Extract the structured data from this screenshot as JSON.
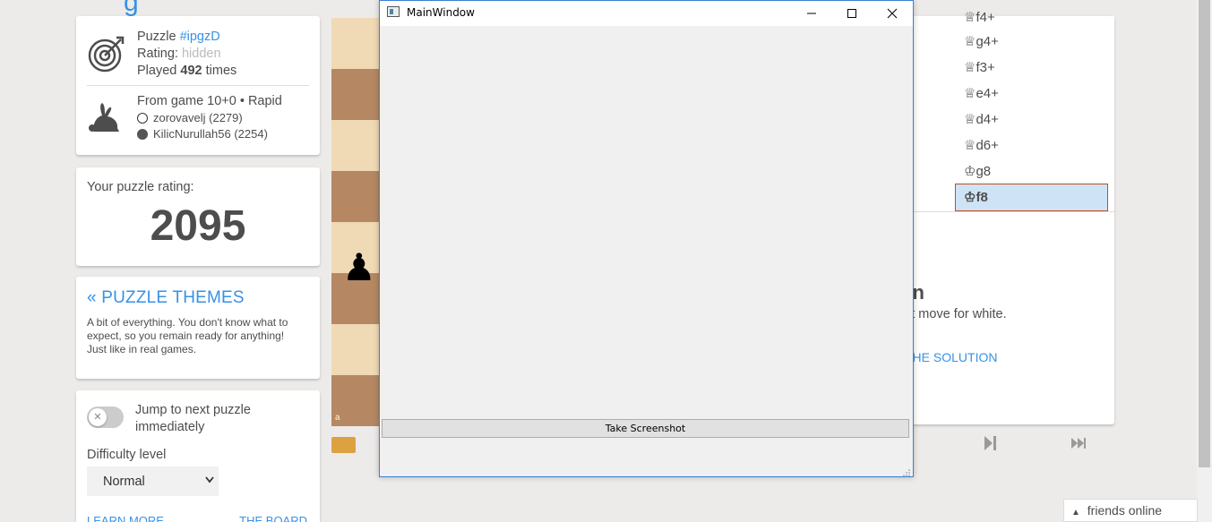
{
  "heading_fragment": "g",
  "puzzle": {
    "label": "Puzzle",
    "id": "#ipgzD",
    "rating_label": "Rating:",
    "rating_value": "hidden",
    "played_prefix": "Played",
    "played_count": "492",
    "played_suffix": "times",
    "game_info": "From game 10+0 • Rapid",
    "white_player": "zorovavelj (2279)",
    "black_player": "KilicNurullah56 (2254)"
  },
  "rating": {
    "label": "Your puzzle rating:",
    "value": "2095"
  },
  "themes": {
    "link": "« PUZZLE THEMES",
    "description": "A bit of everything. You don't know what to expect, so you remain ready for anything! Just like in real games."
  },
  "settings": {
    "toggle_label": "Jump to next puzzle immediately",
    "toggle_on": false,
    "difficulty_label": "Difficulty level",
    "difficulty_value": "Normal",
    "link_left": "LEARN MORE",
    "link_right": "THE BOARD"
  },
  "board": {
    "coord_label": "a",
    "piece": "black-pawn"
  },
  "moves": {
    "list": [
      "♕f4+",
      "♕g4+",
      "♕f3+",
      "♕e4+",
      "♕d4+",
      "♕d6+",
      "♔g8"
    ],
    "active": "♔f8"
  },
  "turn": {
    "heading": "rn",
    "subtext": "st move for white.",
    "solution": "THE SOLUTION"
  },
  "friends": {
    "label": "friends online"
  },
  "qt_window": {
    "title": "MainWindow",
    "button_label": "Take Screenshot"
  },
  "colors": {
    "accent": "#3692e7",
    "board_light": "#f0d9b5",
    "board_dark": "#b58863",
    "active_move_bg": "#cfe3f6",
    "active_move_border": "#c04c24"
  }
}
